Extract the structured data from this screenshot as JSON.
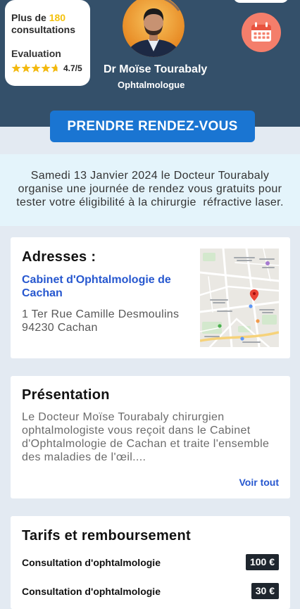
{
  "colors": {
    "header_bg": "#34506a",
    "page_bg": "#e3eaf2",
    "banner_bg": "#e4f4fb",
    "accent_blue": "#1a75d2",
    "link_blue": "#2657cf",
    "highlight_yellow": "#f4c20d",
    "star_gold": "#f3b90f",
    "star_empty": "#ffffff",
    "calendar_bg": "#f47e6b",
    "badge_bg": "#1f262e"
  },
  "icons": {
    "calendar": "calendar-icon",
    "rating": "star-icon",
    "location": "map-pin-icon"
  },
  "header": {
    "stats_card": {
      "consultations_prefix": "Plus de",
      "consultations_count": "180",
      "consultations_suffix": "consultations",
      "rating_title": "Evaluation",
      "rating_value": 4.7,
      "rating_max": 5,
      "rating_label": "4.7/5"
    },
    "doctor": {
      "name": "Dr Moïse Tourabaly",
      "specialty": "Ophtalmologue"
    },
    "book_button_label": "PRENDRE RENDEZ-VOUS"
  },
  "banner": {
    "lines": [
      "Samedi 13 Janvier 2024 le Docteur Tourabaly",
      "organise une journée de rendez vous gratuits pour",
      "tester votre éligibilité à la chirurgie  réfractive laser."
    ]
  },
  "addresses": {
    "title": "Adresses :",
    "clinic_name": "Cabinet d'Ophtalmologie de Cachan",
    "address_line1": "1 Ter Rue Camille Desmoulins",
    "address_line2": "94230 Cachan"
  },
  "presentation": {
    "title": "Présentation",
    "excerpt_lines": [
      "Le Docteur Moïse Tourabaly chirurgien",
      "ophtalmologiste vous reçoit dans le Cabinet",
      "d'Ophtalmologie de Cachan et traite l'ensemble",
      "des maladies de l'œil...."
    ],
    "more_label": "Voir tout"
  },
  "pricing": {
    "title": "Tarifs et remboursement",
    "items": [
      {
        "label": "Consultation d'ophtalmologie",
        "price": "100 €"
      },
      {
        "label": "Consultation d'ophtalmologie",
        "price": "30 €"
      }
    ]
  }
}
